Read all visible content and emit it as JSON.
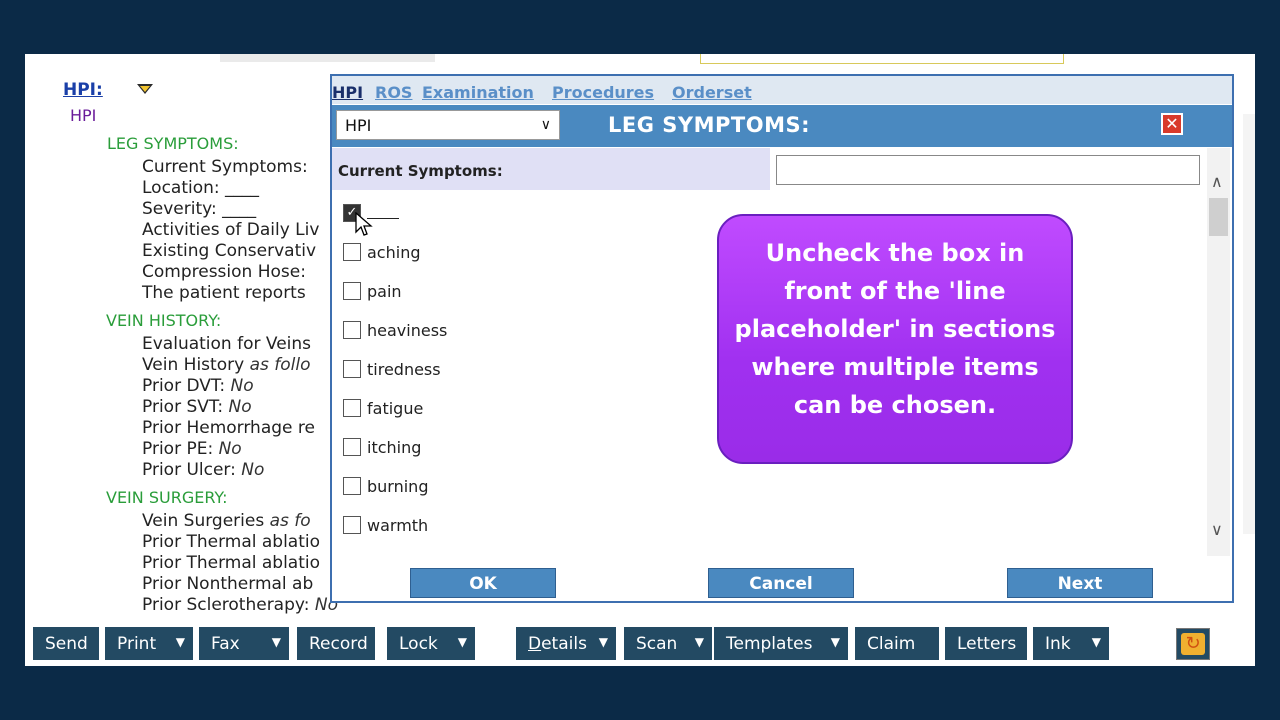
{
  "note": {
    "hpi_link": "HPI:",
    "hpi_sub": "HPI",
    "sections": {
      "leg": "LEG SYMPTOMS:",
      "vein_history": "VEIN HISTORY:",
      "vein_surgery": "VEIN SURGERY:"
    },
    "leg_lines": [
      "Current Symptoms:",
      "Location:  ____",
      "Severity:  ____",
      "Activities of Daily Liv",
      "Existing Conservativ",
      "Compression Hose:",
      "The patient reports"
    ],
    "vein_lines": [
      {
        "label": "Evaluation for Veins",
        "value": ""
      },
      {
        "label": "Vein History ",
        "value": "as follo"
      },
      {
        "label": "Prior DVT: ",
        "value": "No"
      },
      {
        "label": "Prior SVT: ",
        "value": "No"
      },
      {
        "label": "Prior Hemorrhage re",
        "value": ""
      },
      {
        "label": "Prior PE: ",
        "value": "No"
      },
      {
        "label": "Prior Ulcer: ",
        "value": "No"
      }
    ],
    "surgery_lines": [
      {
        "label": "Vein Surgeries ",
        "value": "as fo"
      },
      {
        "label": "Prior Thermal ablatio",
        "value": ""
      },
      {
        "label": "Prior Thermal ablatio",
        "value": ""
      },
      {
        "label": "Prior Nonthermal ab",
        "value": ""
      },
      {
        "label": "Prior Sclerotherapy: ",
        "value": "No"
      }
    ]
  },
  "dialog": {
    "tabs": [
      "HPI",
      "ROS",
      "Examination",
      "Procedures",
      "Orderset"
    ],
    "select_value": "HPI",
    "title": "LEG SYMPTOMS:",
    "field_label": "Current Symptoms:",
    "field_value": "",
    "options": [
      "aching",
      "pain",
      "heaviness",
      "tiredness",
      "fatigue",
      "itching",
      "burning",
      "warmth"
    ],
    "callout": "Uncheck the box in front of the 'line placeholder' in sections where multiple items can be chosen.",
    "buttons": {
      "ok": "OK",
      "cancel": "Cancel",
      "next": "Next"
    }
  },
  "toolbar": {
    "send": "Send",
    "print": "Print",
    "fax": "Fax",
    "record": "Record",
    "lock": "Lock",
    "details_u": "D",
    "details_rest": "etails",
    "scan": "Scan",
    "templates": "Templates",
    "claim": "Claim",
    "letters": "Letters",
    "ink": "Ink"
  },
  "colors": {
    "toolbar_button": "#234a63",
    "dialog_title": "#4a89c0",
    "section_green": "#2a9d3a",
    "callout_purple": "#a030f0",
    "background": "#0b2a47"
  },
  "icons": {
    "close": "close-icon",
    "refresh": "refresh-icon",
    "dropdown": "triangle-down-icon",
    "cursor": "mouse-pointer-icon"
  }
}
